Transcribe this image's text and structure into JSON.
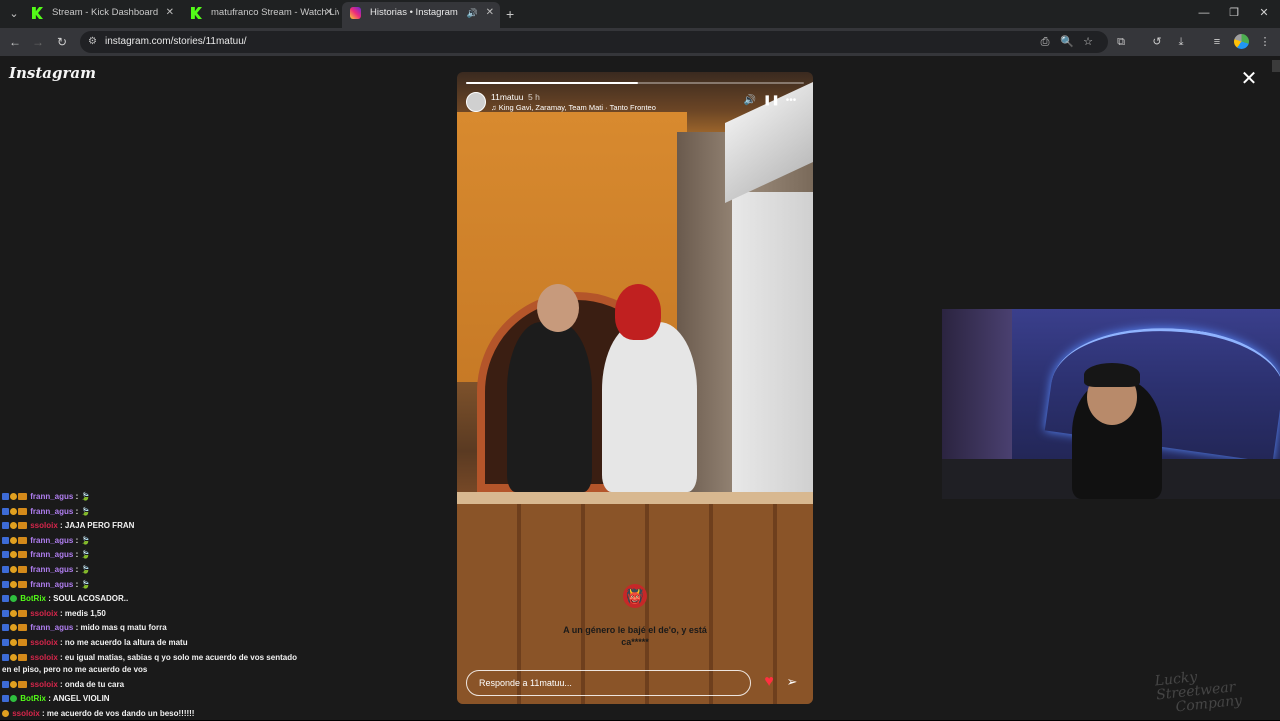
{
  "browser": {
    "tabs": [
      {
        "title": "Stream - Kick Dashboard",
        "favicon": "kick-icon",
        "active": false
      },
      {
        "title": "matufranco Stream - Watch Liv",
        "favicon": "kick-icon",
        "active": false
      },
      {
        "title": "Historias • Instagram",
        "favicon": "instagram-icon",
        "active": true
      }
    ],
    "url": "instagram.com/stories/11matuu/"
  },
  "instagram": {
    "logo": "Instagram",
    "story": {
      "username": "11matuu",
      "time": "5 h",
      "song": "King Gavi, Zaramay, Team Mati · Tanto Fronteo",
      "progress": 0.51,
      "caption": "A un género le bajé el de'o, y está ca*****",
      "reply_placeholder": "Responde a 11matuu..."
    }
  },
  "chat": [
    {
      "user": "frann_agus",
      "user_color": "#b07ef0",
      "text": ": 🍃",
      "badges": [
        "blue",
        "gold",
        "orange"
      ]
    },
    {
      "user": "frann_agus",
      "user_color": "#b07ef0",
      "text": ": 🍃",
      "badges": [
        "blue",
        "gold",
        "orange"
      ]
    },
    {
      "user": "ssoloix",
      "user_color": "#d6264b",
      "text": ": JAJA PERO FRAN",
      "badges": [
        "blue",
        "gold",
        "orange"
      ]
    },
    {
      "user": "frann_agus",
      "user_color": "#b07ef0",
      "text": ": 🍃",
      "badges": [
        "blue",
        "gold",
        "orange"
      ]
    },
    {
      "user": "frann_agus",
      "user_color": "#b07ef0",
      "text": ": 🍃",
      "badges": [
        "blue",
        "gold",
        "orange"
      ]
    },
    {
      "user": "frann_agus",
      "user_color": "#b07ef0",
      "text": ": 🍃",
      "badges": [
        "blue",
        "gold",
        "orange"
      ]
    },
    {
      "user": "frann_agus",
      "user_color": "#b07ef0",
      "text": ": 🍃",
      "badges": [
        "blue",
        "gold",
        "orange"
      ]
    },
    {
      "user": "BotRix",
      "user_color": "#53fc18",
      "text": ": SOUL ACOSADOR..",
      "badges": [
        "blue",
        "green"
      ]
    },
    {
      "user": "ssoloix",
      "user_color": "#d6264b",
      "text": ": medis 1,50",
      "badges": [
        "blue",
        "gold",
        "orange"
      ]
    },
    {
      "user": "frann_agus",
      "user_color": "#b07ef0",
      "text": ": mido mas q matu forra",
      "badges": [
        "blue",
        "gold",
        "orange"
      ]
    },
    {
      "user": "ssoloix",
      "user_color": "#d6264b",
      "text": ": no me acuerdo la altura de matu",
      "badges": [
        "blue",
        "gold",
        "orange"
      ]
    },
    {
      "user": "ssoloix",
      "user_color": "#d6264b",
      "text": ": eu igual matias, sabias q yo solo me acuerdo de vos sentado en el piso, pero no me acuerdo de vos",
      "badges": [
        "blue",
        "gold",
        "orange"
      ],
      "wrap": true
    },
    {
      "user": "ssoloix",
      "user_color": "#d6264b",
      "text": ": onda de tu cara",
      "badges": [
        "blue",
        "gold",
        "orange"
      ]
    },
    {
      "user": "BotRix",
      "user_color": "#53fc18",
      "text": ": ANGEL VIOLIN",
      "badges": [
        "blue",
        "green"
      ]
    },
    {
      "user": "ssoloix",
      "user_color": "#d6264b",
      "text": ": me acuerdo de vos dando un beso!!!!!!",
      "badges": [
        "gold"
      ]
    }
  ],
  "watermark": {
    "line1": "Lucky Streetwear",
    "line2": "Company"
  }
}
